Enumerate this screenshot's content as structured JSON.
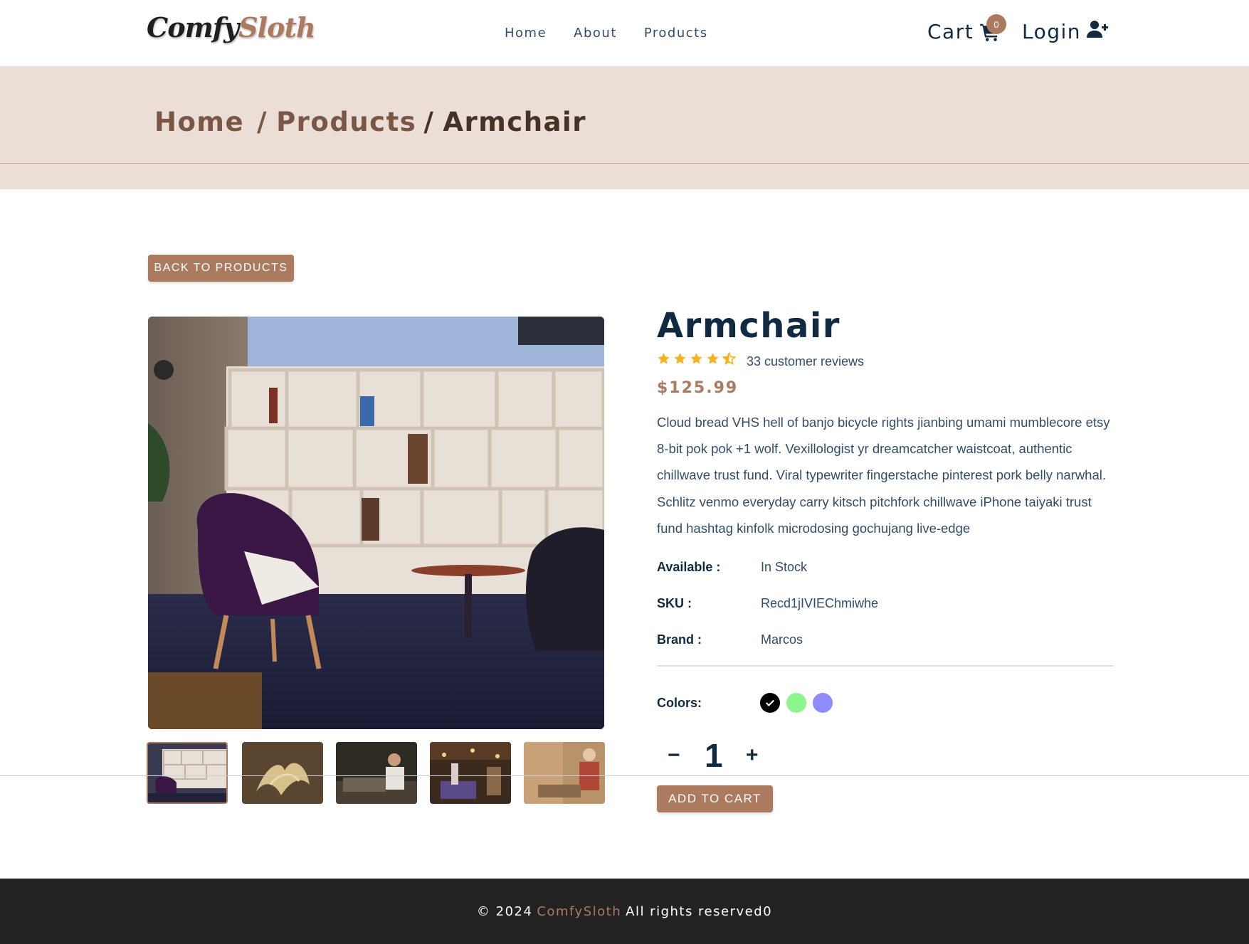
{
  "brand": {
    "name_part1": "Comfy",
    "name_part2": "Sloth"
  },
  "nav": {
    "links": [
      "Home",
      "About",
      "Products"
    ]
  },
  "header_actions": {
    "cart_label": "Cart",
    "cart_count": "0",
    "login_label": "Login"
  },
  "breadcrumb": {
    "home": "Home",
    "sep": "/",
    "products": "Products",
    "current": "Armchair"
  },
  "back_button": "BACK TO PRODUCTS",
  "product": {
    "name": "Armchair",
    "rating": 4.5,
    "reviews_text": "33 customer reviews",
    "price": "$125.99",
    "description": "Cloud bread VHS hell of banjo bicycle rights jianbing umami mumblecore etsy 8-bit pok pok +1 wolf. Vexillologist yr dreamcatcher waistcoat, authentic chillwave trust fund. Viral typewriter fingerstache pinterest pork belly narwhal. Schlitz venmo everyday carry kitsch pitchfork chillwave iPhone taiyaki trust fund hashtag kinfolk microdosing gochujang live-edge",
    "info": [
      {
        "label": "Available :",
        "value": "In Stock"
      },
      {
        "label": "SKU :",
        "value": "Recd1jIVIEChmiwhe"
      },
      {
        "label": "Brand :",
        "value": "Marcos"
      }
    ],
    "colors_label": "Colors:",
    "colors": [
      "#000000",
      "#80f581",
      "#8080ff"
    ],
    "selected_color": "#000000",
    "quantity": "1",
    "qty_minus": "−",
    "qty_plus": "+",
    "add_to_cart": "ADD TO CART"
  },
  "gallery": {
    "selected_index": 0,
    "count": 5
  },
  "theme": {
    "accent": "#ab7a5f",
    "hero_bg": "#eaded7",
    "dark": "#102a42",
    "footer_bg": "#222222",
    "star": "#f6b31e"
  },
  "footer": {
    "prefix": "© 2024",
    "brand": "ComfySloth",
    "suffix": "All rights reserved0"
  }
}
